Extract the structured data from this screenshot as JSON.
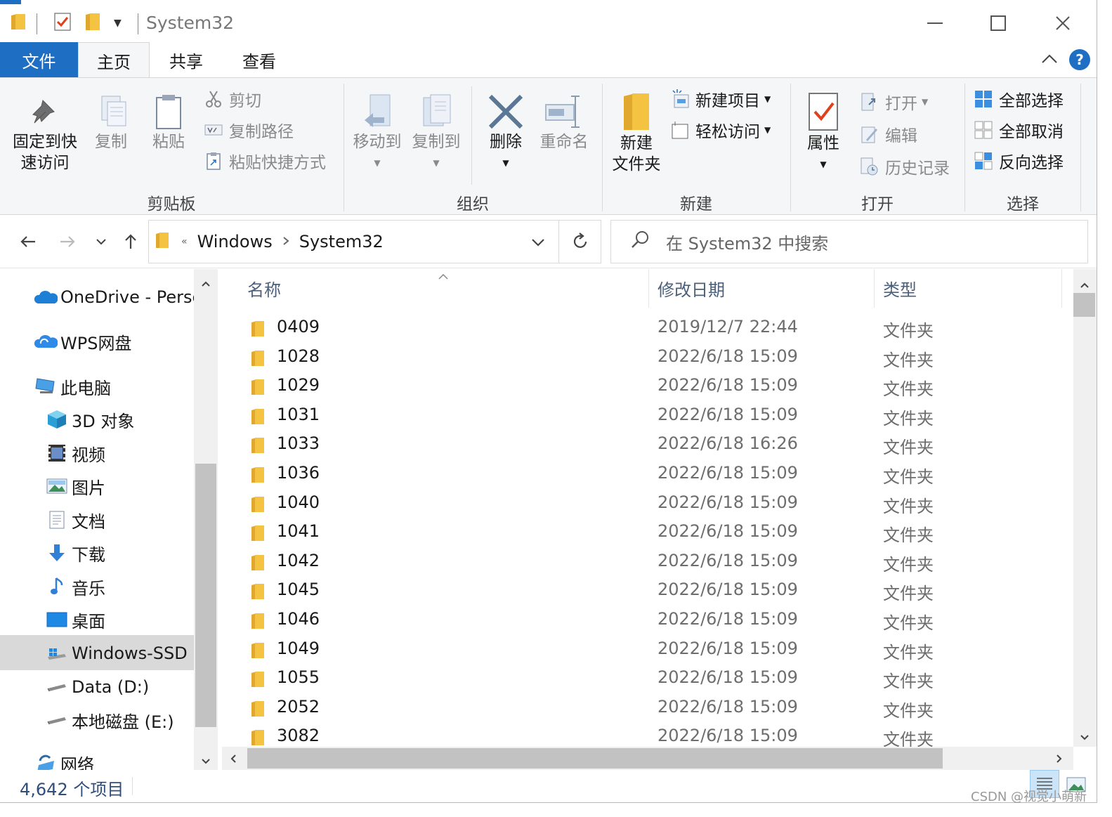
{
  "window": {
    "title": "System32"
  },
  "ribbon_tabs": [
    {
      "label": "文件"
    },
    {
      "label": "主页"
    },
    {
      "label": "共享"
    },
    {
      "label": "查看"
    }
  ],
  "ribbon": {
    "clipboard": {
      "group_label": "剪贴板",
      "pin_label_1": "固定到快",
      "pin_label_2": "速访问",
      "copy_label": "复制",
      "paste_label": "粘贴",
      "cut_label": "剪切",
      "copy_path_label": "复制路径",
      "paste_shortcut_label": "粘贴快捷方式"
    },
    "organize": {
      "group_label": "组织",
      "move_to_label": "移动到",
      "copy_to_label": "复制到",
      "delete_label": "删除",
      "rename_label": "重命名"
    },
    "new": {
      "group_label": "新建",
      "new_folder_label_1": "新建",
      "new_folder_label_2": "文件夹",
      "new_item_label": "新建项目",
      "easy_access_label": "轻松访问"
    },
    "open": {
      "group_label": "打开",
      "properties_label": "属性",
      "open_label": "打开",
      "edit_label": "编辑",
      "history_label": "历史记录"
    },
    "select": {
      "group_label": "选择",
      "select_all_label": "全部选择",
      "select_none_label": "全部取消",
      "invert_label": "反向选择"
    }
  },
  "address": {
    "overflow": "«",
    "segments": [
      "Windows",
      "System32"
    ]
  },
  "search": {
    "placeholder": "在 System32 中搜索"
  },
  "nav": {
    "items": [
      {
        "label": "OneDrive - Persc",
        "icon": "onedrive-icon"
      },
      {
        "label": "WPS网盘",
        "icon": "wps-cloud-icon"
      },
      {
        "label": "此电脑",
        "icon": "computer-icon"
      },
      {
        "label": "3D 对象",
        "icon": "3d-objects-icon"
      },
      {
        "label": "视频",
        "icon": "video-icon"
      },
      {
        "label": "图片",
        "icon": "pictures-icon"
      },
      {
        "label": "文档",
        "icon": "documents-icon"
      },
      {
        "label": "下载",
        "icon": "download-icon"
      },
      {
        "label": "音乐",
        "icon": "music-icon"
      },
      {
        "label": "桌面",
        "icon": "desktop-icon"
      },
      {
        "label": "Windows-SSD (",
        "icon": "drive-windows-icon"
      },
      {
        "label": "Data (D:)",
        "icon": "drive-icon"
      },
      {
        "label": "本地磁盘 (E:)",
        "icon": "drive-icon"
      },
      {
        "label": "网络",
        "icon": "network-icon"
      }
    ]
  },
  "columns": {
    "name": "名称",
    "date": "修改日期",
    "type": "类型"
  },
  "files": [
    {
      "name": "0409",
      "date": "2019/12/7 22:44",
      "type": "文件夹"
    },
    {
      "name": "1028",
      "date": "2022/6/18 15:09",
      "type": "文件夹"
    },
    {
      "name": "1029",
      "date": "2022/6/18 15:09",
      "type": "文件夹"
    },
    {
      "name": "1031",
      "date": "2022/6/18 15:09",
      "type": "文件夹"
    },
    {
      "name": "1033",
      "date": "2022/6/18 16:26",
      "type": "文件夹"
    },
    {
      "name": "1036",
      "date": "2022/6/18 15:09",
      "type": "文件夹"
    },
    {
      "name": "1040",
      "date": "2022/6/18 15:09",
      "type": "文件夹"
    },
    {
      "name": "1041",
      "date": "2022/6/18 15:09",
      "type": "文件夹"
    },
    {
      "name": "1042",
      "date": "2022/6/18 15:09",
      "type": "文件夹"
    },
    {
      "name": "1045",
      "date": "2022/6/18 15:09",
      "type": "文件夹"
    },
    {
      "name": "1046",
      "date": "2022/6/18 15:09",
      "type": "文件夹"
    },
    {
      "name": "1049",
      "date": "2022/6/18 15:09",
      "type": "文件夹"
    },
    {
      "name": "1055",
      "date": "2022/6/18 15:09",
      "type": "文件夹"
    },
    {
      "name": "2052",
      "date": "2022/6/18 15:09",
      "type": "文件夹"
    },
    {
      "name": "3082",
      "date": "2022/6/18 15:09",
      "type": "文件夹"
    }
  ],
  "status": {
    "item_count": "4,642 个项目"
  },
  "watermark": "CSDN @视觉小萌新",
  "colors": {
    "accent": "#1e6fc4",
    "folder": "#f5c342",
    "folder_dark": "#e0a82e"
  }
}
